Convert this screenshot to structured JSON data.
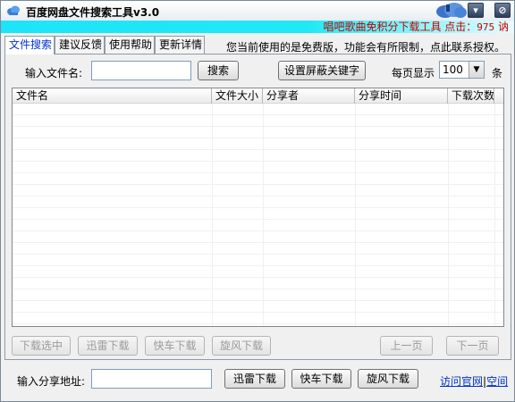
{
  "window": {
    "title": "百度网盘文件搜索工具v3.0",
    "icons": [
      "app-cloud-icon",
      "skin-cloud-icon",
      "minimize-icon",
      "close-icon"
    ]
  },
  "strip": {
    "text": "唱吧歌曲免积分下载工具 点击：",
    "count": "975",
    "tail": "讷"
  },
  "tabs": [
    "文件搜索",
    "建议反馈",
    "使用帮助",
    "更新详情"
  ],
  "notice": "您当前使用的是免费版，功能会有所限制，点此联系授权。",
  "search": {
    "label": "输入文件名:",
    "value": "",
    "button": "搜索",
    "block_button": "设置屏蔽关键字",
    "per_page_label": "每页显示",
    "per_page_value": "100",
    "per_page_unit": "条"
  },
  "table": {
    "columns": [
      "文件名",
      "文件大小",
      "分享者",
      "分享时间",
      "下载次数"
    ],
    "rows": []
  },
  "actions": {
    "download_selected": "下载选中",
    "xunlei": "迅雷下载",
    "kuaiche": "快车下载",
    "xuanfeng": "旋风下载",
    "prev": "上一页",
    "next": "下一页"
  },
  "share": {
    "label": "输入分享地址:",
    "value": "",
    "xunlei": "迅雷下载",
    "kuaiche": "快车下载",
    "xuanfeng": "旋风下载"
  },
  "links": {
    "site": "访问官网",
    "sep": "|",
    "space": "空间"
  },
  "colors": {
    "strip": "#1ee4f7",
    "strip_text": "#c50000",
    "link": "#0033cc"
  }
}
